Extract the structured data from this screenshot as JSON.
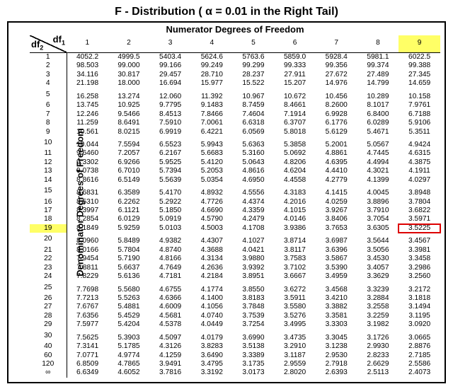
{
  "title_prefix": "F - Distribution ( ",
  "title_alpha": "α",
  "title_suffix": " = 0.01 in the Right Tail)",
  "numerator_label": "Numerator Degrees of Freedom",
  "denominator_label": "Denominator Degrees of Freedom",
  "df1_label": "df",
  "df1_sub": "1",
  "df2_label": "df",
  "df2_sub": "2",
  "highlight_col": 9,
  "highlight_row": 19,
  "chart_data": {
    "type": "table",
    "title": "F-Distribution critical values, alpha = 0.01 right tail",
    "col_headers": [
      1,
      2,
      3,
      4,
      5,
      6,
      7,
      8,
      9
    ],
    "row_headers": [
      1,
      2,
      3,
      4,
      5,
      6,
      7,
      8,
      9,
      10,
      11,
      12,
      13,
      14,
      15,
      16,
      17,
      18,
      19,
      20,
      21,
      22,
      23,
      24,
      25,
      26,
      27,
      28,
      29,
      30,
      40,
      60,
      120,
      "∞"
    ],
    "group_breaks": [
      5,
      10,
      15,
      20,
      25,
      30
    ],
    "values": [
      [
        "4052.2",
        "4999.5",
        "5403.4",
        "5624.6",
        "5763.6",
        "5859.0",
        "5928.4",
        "5981.1",
        "6022.5"
      ],
      [
        "98.503",
        "99.000",
        "99.166",
        "99.249",
        "99.299",
        "99.333",
        "99.356",
        "99.374",
        "99.388"
      ],
      [
        "34.116",
        "30.817",
        "29.457",
        "28.710",
        "28.237",
        "27.911",
        "27.672",
        "27.489",
        "27.345"
      ],
      [
        "21.198",
        "18.000",
        "16.694",
        "15.977",
        "15.522",
        "15.207",
        "14.976",
        "14.799",
        "14.659"
      ],
      [
        "16.258",
        "13.274",
        "12.060",
        "11.392",
        "10.967",
        "10.672",
        "10.456",
        "10.289",
        "10.158"
      ],
      [
        "13.745",
        "10.925",
        "9.7795",
        "9.1483",
        "8.7459",
        "8.4661",
        "8.2600",
        "8.1017",
        "7.9761"
      ],
      [
        "12.246",
        "9.5466",
        "8.4513",
        "7.8466",
        "7.4604",
        "7.1914",
        "6.9928",
        "6.8400",
        "6.7188"
      ],
      [
        "11.259",
        "8.6491",
        "7.5910",
        "7.0061",
        "6.6318",
        "6.3707",
        "6.1776",
        "6.0289",
        "5.9106"
      ],
      [
        "10.561",
        "8.0215",
        "6.9919",
        "6.4221",
        "6.0569",
        "5.8018",
        "5.6129",
        "5.4671",
        "5.3511"
      ],
      [
        "10.044",
        "7.5594",
        "6.5523",
        "5.9943",
        "5.6363",
        "5.3858",
        "5.2001",
        "5.0567",
        "4.9424"
      ],
      [
        "9.6460",
        "7.2057",
        "6.2167",
        "5.6683",
        "5.3160",
        "5.0692",
        "4.8861",
        "4.7445",
        "4.6315"
      ],
      [
        "9.3302",
        "6.9266",
        "5.9525",
        "5.4120",
        "5.0643",
        "4.8206",
        "4.6395",
        "4.4994",
        "4.3875"
      ],
      [
        "9.0738",
        "6.7010",
        "5.7394",
        "5.2053",
        "4.8616",
        "4.6204",
        "4.4410",
        "4.3021",
        "4.1911"
      ],
      [
        "8.8616",
        "6.5149",
        "5.5639",
        "5.0354",
        "4.6950",
        "4.4558",
        "4.2779",
        "4.1399",
        "4.0297"
      ],
      [
        "8.6831",
        "6.3589",
        "5.4170",
        "4.8932",
        "4.5556",
        "4.3183",
        "4.1415",
        "4.0045",
        "3.8948"
      ],
      [
        "8.5310",
        "6.2262",
        "5.2922",
        "4.7726",
        "4.4374",
        "4.2016",
        "4.0259",
        "3.8896",
        "3.7804"
      ],
      [
        "8.3997",
        "6.1121",
        "5.1850",
        "4.6690",
        "4.3359",
        "4.1015",
        "3.9267",
        "3.7910",
        "3.6822"
      ],
      [
        "8.2854",
        "6.0129",
        "5.0919",
        "4.5790",
        "4.2479",
        "4.0146",
        "3.8406",
        "3.7054",
        "3.5971"
      ],
      [
        "8.1849",
        "5.9259",
        "5.0103",
        "4.5003",
        "4.1708",
        "3.9386",
        "3.7653",
        "3.6305",
        "3.5225"
      ],
      [
        "8.0960",
        "5.8489",
        "4.9382",
        "4.4307",
        "4.1027",
        "3.8714",
        "3.6987",
        "3.5644",
        "3.4567"
      ],
      [
        "8.0166",
        "5.7804",
        "4.8740",
        "4.3688",
        "4.0421",
        "3.8117",
        "3.6396",
        "3.5056",
        "3.3981"
      ],
      [
        "7.9454",
        "5.7190",
        "4.8166",
        "4.3134",
        "3.9880",
        "3.7583",
        "3.5867",
        "3.4530",
        "3.3458"
      ],
      [
        "7.8811",
        "5.6637",
        "4.7649",
        "4.2636",
        "3.9392",
        "3.7102",
        "3.5390",
        "3.4057",
        "3.2986"
      ],
      [
        "7.8229",
        "5.6136",
        "4.7181",
        "4.2184",
        "3.8951",
        "3.6667",
        "3.4959",
        "3.3629",
        "3.2560"
      ],
      [
        "7.7698",
        "5.5680",
        "4.6755",
        "4.1774",
        "3.8550",
        "3.6272",
        "3.4568",
        "3.3239",
        "3.2172"
      ],
      [
        "7.7213",
        "5.5263",
        "4.6366",
        "4.1400",
        "3.8183",
        "3.5911",
        "3.4210",
        "3.2884",
        "3.1818"
      ],
      [
        "7.6767",
        "5.4881",
        "4.6009",
        "4.1056",
        "3.7848",
        "3.5580",
        "3.3882",
        "3.2558",
        "3.1494"
      ],
      [
        "7.6356",
        "5.4529",
        "4.5681",
        "4.0740",
        "3.7539",
        "3.5276",
        "3.3581",
        "3.2259",
        "3.1195"
      ],
      [
        "7.5977",
        "5.4204",
        "4.5378",
        "4.0449",
        "3.7254",
        "3.4995",
        "3.3303",
        "3.1982",
        "3.0920"
      ],
      [
        "7.5625",
        "5.3903",
        "4.5097",
        "4.0179",
        "3.6990",
        "3.4735",
        "3.3045",
        "3.1726",
        "3.0665"
      ],
      [
        "7.3141",
        "5.1785",
        "4.3126",
        "3.8283",
        "3.5138",
        "3.2910",
        "3.1238",
        "2.9930",
        "2.8876"
      ],
      [
        "7.0771",
        "4.9774",
        "4.1259",
        "3.6490",
        "3.3389",
        "3.1187",
        "2.9530",
        "2.8233",
        "2.7185"
      ],
      [
        "6.8509",
        "4.7865",
        "3.9491",
        "3.4795",
        "3.1735",
        "2.9559",
        "2.7918",
        "2.6629",
        "2.5586"
      ],
      [
        "6.6349",
        "4.6052",
        "3.7816",
        "3.3192",
        "3.0173",
        "2.8020",
        "2.6393",
        "2.5113",
        "2.4073"
      ]
    ]
  }
}
